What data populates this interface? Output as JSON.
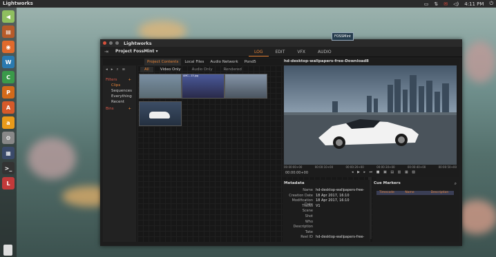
{
  "desktop": {
    "topbar": {
      "app_name": "Lightworks",
      "time": "4:11 PM"
    },
    "launcher": [
      {
        "icon": "back-arrow-icon",
        "color": "#8fbf5f"
      },
      {
        "icon": "files-icon",
        "color": "#b65b2a"
      },
      {
        "icon": "firefox-icon",
        "color": "#e06a2c"
      },
      {
        "icon": "libreoffice-writer-icon",
        "color": "#2a7ab0"
      },
      {
        "icon": "libreoffice-calc-icon",
        "color": "#3a9a4a"
      },
      {
        "icon": "libreoffice-impress-icon",
        "color": "#d36a1a"
      },
      {
        "icon": "software-center-icon",
        "color": "#d55a2a"
      },
      {
        "icon": "amazon-icon",
        "color": "#e99a1a"
      },
      {
        "icon": "settings-icon",
        "color": "#888888"
      },
      {
        "icon": "workspace-icon",
        "color": "#3a4a6a"
      },
      {
        "icon": "terminal-icon",
        "color": "#333333"
      },
      {
        "icon": "lightworks-icon",
        "color": "#c23a3a"
      },
      {
        "icon": "trash-icon",
        "color": "#dddddd"
      }
    ]
  },
  "window": {
    "title": "Lightworks",
    "badge": "FOSSMint",
    "project": "Project FossMint",
    "mode_tabs": [
      {
        "label": "LOG",
        "active": true
      },
      {
        "label": "EDIT",
        "active": false
      },
      {
        "label": "VFX",
        "active": false
      },
      {
        "label": "AUDIO",
        "active": false
      }
    ],
    "content_tabs": [
      {
        "label": "Project Contents",
        "active": true
      },
      {
        "label": "Local Files",
        "active": false
      },
      {
        "label": "Audio Network",
        "active": false
      },
      {
        "label": "Pond5",
        "active": false
      }
    ],
    "sidebar": {
      "filters_head": "Filters",
      "items": [
        "Clips",
        "Sequences",
        "Everything",
        "Recent"
      ],
      "bins_head": "Bins"
    },
    "filters": [
      {
        "label": "All",
        "active": true
      },
      {
        "label": "Video Only",
        "active": false,
        "bright": true
      },
      {
        "label": "Audio Only",
        "active": false
      },
      {
        "label": "Rendered",
        "active": false
      }
    ],
    "thumbs": [
      {
        "label": "",
        "colors": [
          "#7a8fa3",
          "#5a6b73"
        ]
      },
      {
        "label": "AMC...13.jpg",
        "colors": [
          "#4a5a9a",
          "#2a2a4a"
        ]
      },
      {
        "label": "",
        "colors": [
          "#8595a8",
          "#4b5560"
        ]
      },
      {
        "label": "",
        "colors": [
          "#3c4d65",
          "#243040"
        ]
      }
    ],
    "viewer": {
      "title": "hd-desktop-wallpapers-free-Download8",
      "timecodes": [
        "00:00:00+00",
        "00:00:10+00",
        "00:00:20+00",
        "00:00:30+00",
        "00:00:40+00",
        "00:00:50+00"
      ],
      "current_time": "00:00:00+00"
    },
    "metadata": {
      "heading": "Metadata",
      "rows": [
        {
          "key": "Name",
          "value": "hd-desktop-wallpapers-free-"
        },
        {
          "key": "Creation Date",
          "value": "18 Apr 2017, 16:10"
        },
        {
          "key": "Modification Date",
          "value": "18 Apr 2017, 16:10"
        },
        {
          "key": "Tracks",
          "value": "V1"
        },
        {
          "key": "Scene",
          "value": ""
        },
        {
          "key": "Shot",
          "value": ""
        },
        {
          "key": "Who",
          "value": ""
        },
        {
          "key": "Description",
          "value": ""
        },
        {
          "key": "Take",
          "value": ""
        },
        {
          "key": "Reel ID",
          "value": "hd-desktop-wallpapers-free-"
        }
      ]
    },
    "cue_markers": {
      "heading": "Cue Markers",
      "columns": [
        "Timecode",
        "Name",
        "Description"
      ]
    }
  }
}
